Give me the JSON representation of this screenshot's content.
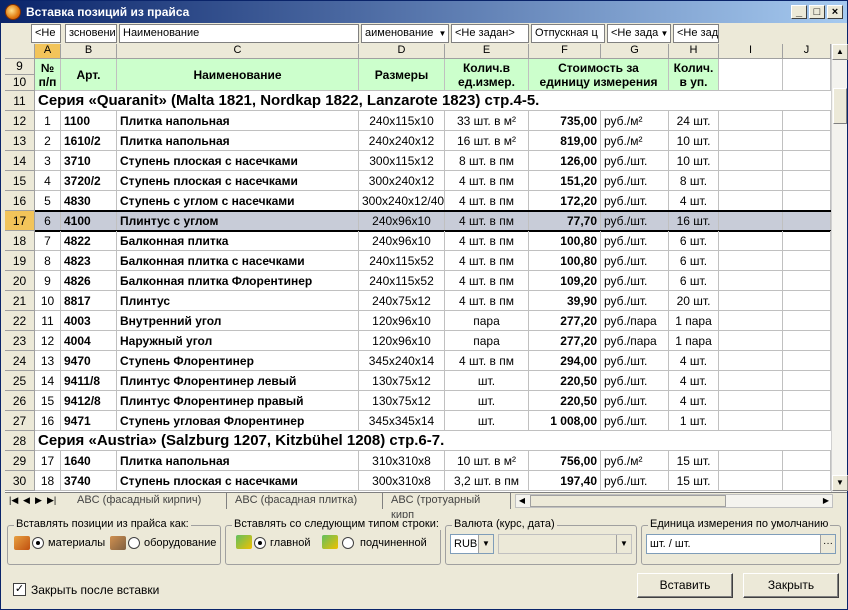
{
  "window": {
    "title": "Вставка позиций из прайса"
  },
  "filters": [
    {
      "text": "<Не",
      "dd": false
    },
    {
      "text": "зсновение",
      "dd": false
    },
    {
      "text": "Наименование",
      "dd": false
    },
    {
      "text": "аименование",
      "dd": true
    },
    {
      "text": "<Не задан>",
      "dd": false
    },
    {
      "text": "Отпускная ц",
      "dd": false
    },
    {
      "text": "<Не зада",
      "dd": true
    },
    {
      "text": "<Не зад",
      "dd": false
    }
  ],
  "columns": [
    "A",
    "B",
    "C",
    "D",
    "E",
    "F",
    "G",
    "H",
    "I",
    "J"
  ],
  "header_rows": [
    "9",
    "10"
  ],
  "header": [
    "№ п/п",
    "Арт.",
    "Наименование",
    "Размеры",
    "Колич.в ед.измер.",
    "Стоимость за единицу измерения",
    "",
    "Колич. в уп."
  ],
  "rows": [
    {
      "num": "11",
      "series": "Серия «Quaranit» (Malta 1821, Nordkap 1822, Lanzarote 1823) стр.4-5."
    },
    {
      "num": "12",
      "cells": [
        "1",
        "1100",
        "Плитка напольная",
        "240x115x10",
        "33 шт. в м²",
        "735,00",
        "руб./м²",
        "24 шт."
      ]
    },
    {
      "num": "13",
      "cells": [
        "2",
        "1610/2",
        "Плитка напольная",
        "240x240x12",
        "16 шт. в м²",
        "819,00",
        "руб./м²",
        "10 шт."
      ]
    },
    {
      "num": "14",
      "cells": [
        "3",
        "3710",
        "Ступень плоская с насечками",
        "300x115x12",
        "8 шт. в пм",
        "126,00",
        "руб./шт.",
        "10 шт."
      ]
    },
    {
      "num": "15",
      "cells": [
        "4",
        "3720/2",
        "Ступень плоская с насечками",
        "300x240x12",
        "4 шт. в пм",
        "151,20",
        "руб./шт.",
        "8 шт."
      ]
    },
    {
      "num": "16",
      "cells": [
        "5",
        "4830",
        "Ступень с углом с насечками",
        "300x240x12/40",
        "4 шт. в пм",
        "172,20",
        "руб./шт.",
        "4 шт."
      ]
    },
    {
      "num": "17",
      "selected": true,
      "cells": [
        "6",
        "4100",
        "Плинтус с углом",
        "240x96x10",
        "4 шт. в пм",
        "77,70",
        "руб./шт.",
        "16 шт."
      ]
    },
    {
      "num": "18",
      "cells": [
        "7",
        "4822",
        "Балконная плитка",
        "240x96x10",
        "4 шт. в пм",
        "100,80",
        "руб./шт.",
        "6 шт."
      ]
    },
    {
      "num": "19",
      "cells": [
        "8",
        "4823",
        "Балконная плитка с насечками",
        "240x115x52",
        "4 шт. в пм",
        "100,80",
        "руб./шт.",
        "6 шт."
      ]
    },
    {
      "num": "20",
      "cells": [
        "9",
        "4826",
        "Балконная плитка Флорентинер",
        "240x115x52",
        "4 шт. в пм",
        "109,20",
        "руб./шт.",
        "6 шт."
      ]
    },
    {
      "num": "21",
      "cells": [
        "10",
        "8817",
        "Плинтус",
        "240x75x12",
        "4 шт. в пм",
        "39,90",
        "руб./шт.",
        "20 шт."
      ]
    },
    {
      "num": "22",
      "cells": [
        "11",
        "4003",
        "Внутренний угол",
        "120x96x10",
        "пара",
        "277,20",
        "руб./пара",
        "1 пара"
      ]
    },
    {
      "num": "23",
      "cells": [
        "12",
        "4004",
        "Наружный угол",
        "120x96x10",
        "пара",
        "277,20",
        "руб./пара",
        "1 пара"
      ]
    },
    {
      "num": "24",
      "cells": [
        "13",
        "9470",
        "Ступень Флорентинер",
        "345x240x14",
        "4 шт. в пм",
        "294,00",
        "руб./шт.",
        "4 шт."
      ]
    },
    {
      "num": "25",
      "cells": [
        "14",
        "9411/8",
        "Плинтус Флорентинер левый",
        "130x75x12",
        "шт.",
        "220,50",
        "руб./шт.",
        "4 шт."
      ]
    },
    {
      "num": "26",
      "cells": [
        "15",
        "9412/8",
        "Плинтус Флорентинер правый",
        "130x75x12",
        "шт.",
        "220,50",
        "руб./шт.",
        "4 шт."
      ]
    },
    {
      "num": "27",
      "cells": [
        "16",
        "9471",
        "Ступень угловая Флорентинер",
        "345x345x14",
        "шт.",
        "1 008,00",
        "руб./шт.",
        "1 шт."
      ]
    },
    {
      "num": "28",
      "series": "Серия «Austria» (Salzburg 1207, Kitzbühel 1208) стр.6-7."
    },
    {
      "num": "29",
      "cells": [
        "17",
        "1640",
        "Плитка напольная",
        "310x310x8",
        "10 шт. в м²",
        "756,00",
        "руб./м²",
        "15 шт."
      ]
    },
    {
      "num": "30",
      "cells": [
        "18",
        "3740",
        "Ступень плоская с насечками",
        "300x310x8",
        "3,2 шт. в пм",
        "197,40",
        "руб./шт.",
        "15 шт."
      ]
    }
  ],
  "sheet_tabs": [
    "ABC (фасадный кирпич)",
    "ABC (фасадная плитка)",
    "ABC (тротуарный кирп"
  ],
  "insert_as": {
    "label": "Вставлять позиции из прайса как:",
    "opt1": "материалы",
    "opt2": "оборудование"
  },
  "row_type": {
    "label": "Вставлять со следующим типом строки:",
    "opt1": "главной",
    "opt2": "подчиненной"
  },
  "currency": {
    "label": "Валюта (курс, дата)",
    "value": "RUB"
  },
  "unit": {
    "label": "Единица измерения по умолчанию",
    "value": "шт. / шт."
  },
  "close_after": "Закрыть после вставки",
  "buttons": {
    "insert": "Вставить",
    "close": "Закрыть"
  }
}
